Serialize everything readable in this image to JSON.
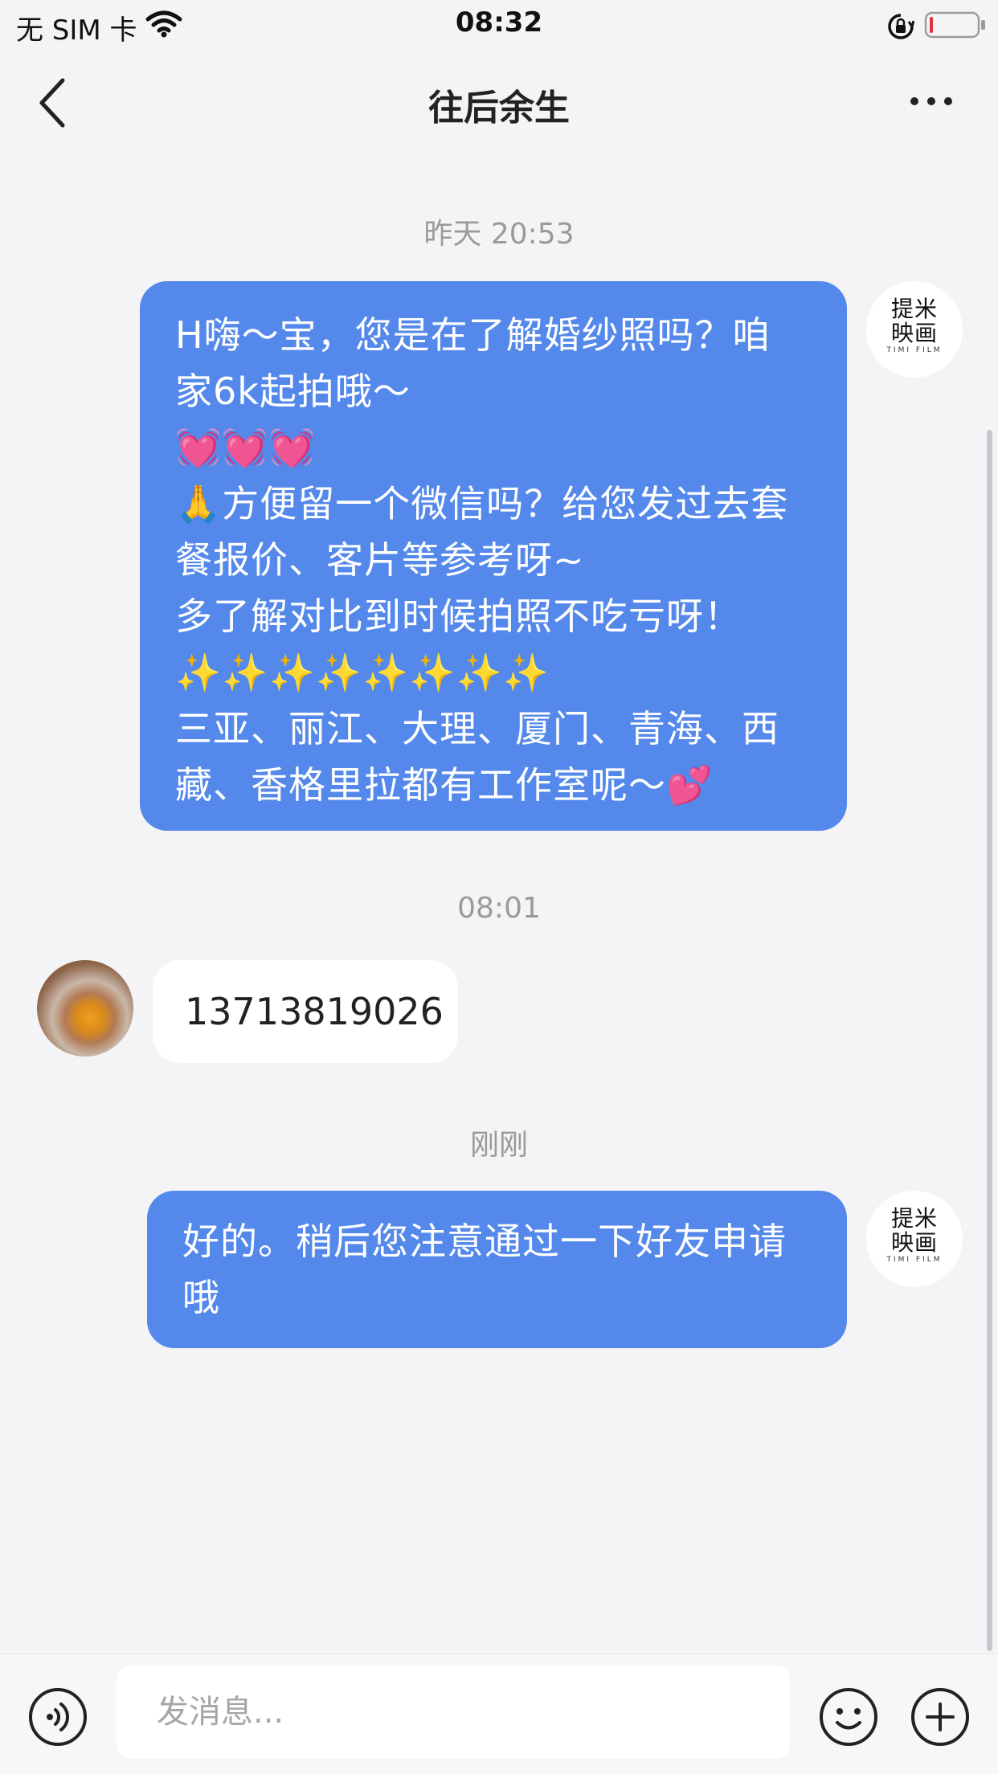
{
  "status_bar": {
    "carrier": "无 SIM 卡",
    "time": "08:32"
  },
  "nav": {
    "title": "往后余生"
  },
  "messages": [
    {
      "timestamp": "昨天 20:53",
      "sender": "brand",
      "lines": [
        "H嗨～宝，您是在了解婚纱照吗？咱",
        "家6k起拍哦～",
        "💓💓💓",
        "🙏方便留一个微信吗？给您发过去套",
        "餐报价、客片等参考呀~",
        "多了解对比到时候拍照不吃亏呀！",
        "✨✨✨✨✨✨✨✨",
        "三亚、丽江、大理、厦门、青海、西",
        "藏、香格里拉都有工作室呢～💕"
      ]
    },
    {
      "timestamp": "08:01",
      "sender": "user",
      "text": "13713819026"
    },
    {
      "timestamp": "刚刚",
      "sender": "brand",
      "lines": [
        "好的。稍后您注意通过一下好友申请",
        "哦"
      ]
    }
  ],
  "brand_avatar": {
    "text_line1": "提米",
    "text_line2": "映画",
    "sub": "TIMI FILM"
  },
  "input": {
    "placeholder": "发消息..."
  },
  "colors": {
    "bubble_outgoing": "#5489eb",
    "bubble_incoming": "#ffffff",
    "background": "#f4f4f6",
    "battery_low": "#e0323c"
  },
  "icons": {
    "back": "chevron-left-icon",
    "more": "more-dots-icon",
    "voice": "voice-icon",
    "emoji": "emoji-icon",
    "plus": "plus-icon"
  }
}
